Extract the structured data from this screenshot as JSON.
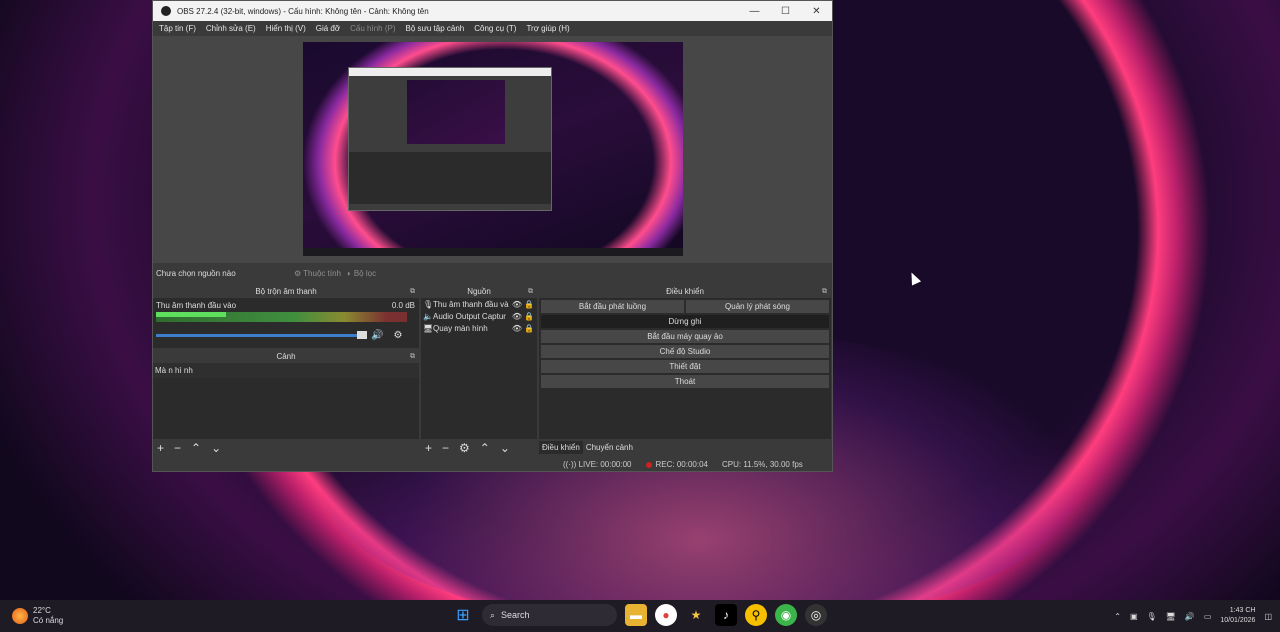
{
  "window": {
    "title": "OBS 27.2.4 (32-bit, windows) - Cấu hình: Không tên - Cảnh: Không tên",
    "controls": {
      "minimize": "—",
      "maximize": "☐",
      "close": "✕"
    }
  },
  "menu": {
    "items": [
      "Tập tin (F)",
      "Chỉnh sửa (E)",
      "Hiển thị (V)",
      "Giá đỡ",
      "Cấu hình (P)",
      "Bộ sưu tập cảnh",
      "Công cụ (T)",
      "Trợ giúp (H)"
    ]
  },
  "source_toolbar": {
    "no_selection": "Chưa chọn nguồn nào",
    "properties": "Thuộc tính",
    "filters": "Bộ lọc"
  },
  "mixer": {
    "title": "Bộ trộn âm thanh",
    "channel_name": "Thu âm thanh đầu vào",
    "channel_db": "0.0 dB",
    "level_fraction": 0.28
  },
  "scenes": {
    "title": "Cảnh",
    "items": [
      "Mà n hì nh"
    ]
  },
  "sources": {
    "title": "Nguồn",
    "items": [
      {
        "label": "Thu âm thanh đầu và",
        "icon": "mic-icon"
      },
      {
        "label": "Audio Output Captur",
        "icon": "speaker-icon"
      },
      {
        "label": "Quay màn hình",
        "icon": "monitor-icon"
      }
    ]
  },
  "controls": {
    "title": "Điều khiển",
    "start_stream": "Bắt đầu phát luồng",
    "manage_stream": "Quản lý phát sóng",
    "stop_recording": "Dừng ghi",
    "virtual_camera": "Bắt đầu máy quay ảo",
    "studio_mode": "Chế độ Studio",
    "settings": "Thiết đặt",
    "exit": "Thoát"
  },
  "dock_tabs": [
    "Điều khiển",
    "Chuyển cảnh"
  ],
  "status": {
    "live": "LIVE: 00:00:00",
    "rec": "REC: 00:00:04",
    "cpu": "CPU: 11.5%, 30.00 fps"
  },
  "taskbar": {
    "weather_temp": "22°C",
    "weather_desc": "Có nắng",
    "search": "Search",
    "time": "1:43 CH",
    "date": "10/01/2026"
  }
}
